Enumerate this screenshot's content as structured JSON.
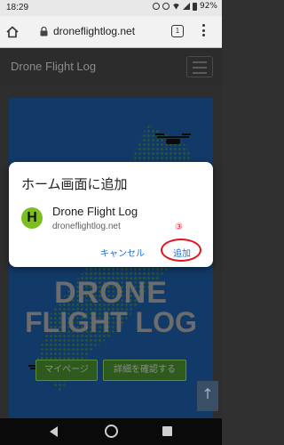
{
  "status_bar": {
    "time": "18:29",
    "battery": "92%"
  },
  "browser": {
    "url": "droneflightlog.net",
    "tab_count": "1"
  },
  "site": {
    "title": "Drone Flight Log"
  },
  "hero": {
    "line1": "DRONE",
    "line2": "FLIGHT LOG",
    "mypage_button": "マイページ",
    "details_button": "詳細を確認する",
    "scroll_top": "↑"
  },
  "dialog": {
    "title": "ホーム画面に追加",
    "app_icon_letter": "H",
    "app_name": "Drone Flight Log",
    "app_url": "droneflightlog.net",
    "cancel_label": "キャンセル",
    "add_label": "追加",
    "step_marker": "③"
  },
  "colors": {
    "accent": "#1a6fd1",
    "highlight": "#e0151d",
    "app_icon_bg": "#7bbf1f"
  }
}
